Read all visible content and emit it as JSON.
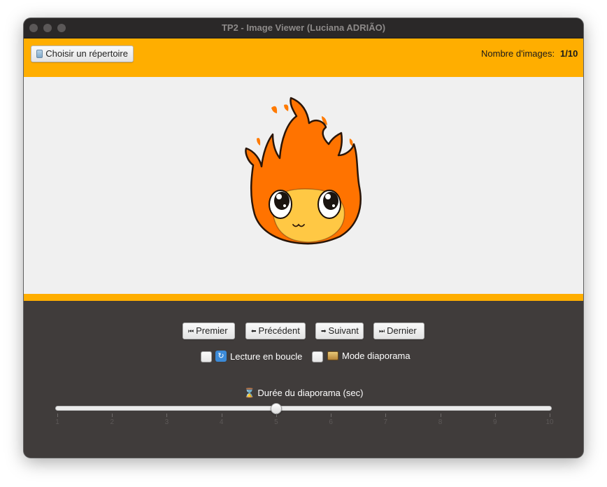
{
  "window": {
    "title": "TP2 - Image Viewer (Luciana ADRIÃO)"
  },
  "toolbar": {
    "choose_dir_label": "Choisir un répertoire",
    "image_count_label": "Nombre d'images:",
    "image_count_value": "1/10"
  },
  "viewer": {
    "current_image": "cartoon-fire-character",
    "image_index": 1,
    "image_total": 10
  },
  "nav": {
    "first": {
      "glyph": "⏮",
      "label": "Premier"
    },
    "prev": {
      "glyph": "⬅",
      "label": "Précédent"
    },
    "next": {
      "glyph": "➡",
      "label": "Suivant"
    },
    "last": {
      "glyph": "⏭",
      "label": "Dernier"
    }
  },
  "options": {
    "loop": {
      "label": "Lecture en boucle",
      "checked": false,
      "icon": "loop-icon"
    },
    "slideshow": {
      "label": "Mode diaporama",
      "checked": false,
      "icon": "slideshow-icon"
    }
  },
  "slider": {
    "label": "⌛ Durée du diaporama (sec)",
    "min": 1,
    "max": 10,
    "value": 5,
    "ticks": [
      "1",
      "2",
      "3",
      "4",
      "5",
      "6",
      "7",
      "8",
      "9",
      "10"
    ]
  },
  "colors": {
    "accent": "#ffae00",
    "panel": "#403c3b",
    "image_bg": "#f0f0f0",
    "titlebar": "#2a2828"
  }
}
